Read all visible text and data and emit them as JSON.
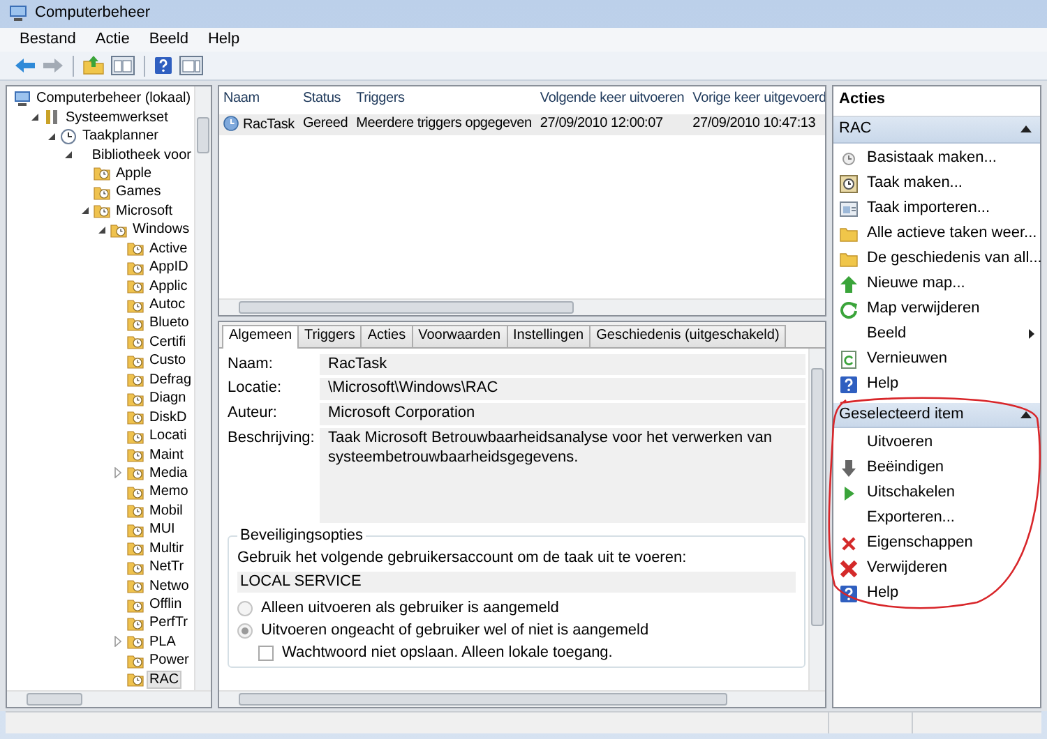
{
  "window": {
    "title": "Computerbeheer"
  },
  "menu": [
    "Bestand",
    "Actie",
    "Beeld",
    "Help"
  ],
  "tree": [
    {
      "label": "Computerbeheer (lokaal)",
      "children": [
        {
          "label": "Systeemwerkset",
          "expanded": true,
          "children": [
            {
              "label": "Taakplanner",
              "expanded": true,
              "children": [
                {
                  "label": "Bibliotheek voor",
                  "expanded": true,
                  "children": [
                    {
                      "label": "Apple"
                    },
                    {
                      "label": "Games"
                    },
                    {
                      "label": "Microsoft",
                      "expanded": true,
                      "children": [
                        {
                          "label": "Windows",
                          "expanded": true,
                          "children": [
                            {
                              "label": "Active",
                              "selected": false
                            },
                            {
                              "label": "AppID",
                              "selected": false
                            },
                            {
                              "label": "Applic",
                              "selected": false
                            },
                            {
                              "label": "Autoc",
                              "selected": false
                            },
                            {
                              "label": "Blueto",
                              "selected": false
                            },
                            {
                              "label": "Certifi",
                              "selected": false
                            },
                            {
                              "label": "Custo",
                              "selected": false
                            },
                            {
                              "label": "Defrag",
                              "selected": false
                            },
                            {
                              "label": "Diagn",
                              "selected": false
                            },
                            {
                              "label": "DiskD",
                              "selected": false
                            },
                            {
                              "label": "Locati",
                              "selected": false
                            },
                            {
                              "label": "Maint",
                              "selected": false
                            },
                            {
                              "label": "Media",
                              "selected": false,
                              "expanded": false
                            },
                            {
                              "label": "Memo",
                              "selected": false
                            },
                            {
                              "label": "Mobil",
                              "selected": false
                            },
                            {
                              "label": "MUI",
                              "selected": false
                            },
                            {
                              "label": "Multir",
                              "selected": false
                            },
                            {
                              "label": "NetTr",
                              "selected": false
                            },
                            {
                              "label": "Netwo",
                              "selected": false
                            },
                            {
                              "label": "Offlin",
                              "selected": false
                            },
                            {
                              "label": "PerfTr",
                              "selected": false
                            },
                            {
                              "label": "PLA",
                              "selected": false,
                              "expanded": false
                            },
                            {
                              "label": "Power",
                              "selected": false
                            },
                            {
                              "label": "RAC",
                              "selected": true
                            }
                          ]
                        }
                      ]
                    }
                  ]
                }
              ]
            }
          ]
        }
      ]
    }
  ],
  "tasks": {
    "columns": [
      "Naam",
      "Status",
      "Triggers",
      "Volgende keer uitvoeren",
      "Vorige keer uitgevoerd"
    ],
    "rows": [
      {
        "cells": [
          "RacTask",
          "Gereed",
          "Meerdere triggers opgegeven",
          "27/09/2010 12:00:07",
          "27/09/2010 10:47:13"
        ],
        "selected": true
      }
    ]
  },
  "details": {
    "tabs": [
      {
        "label": "Algemeen",
        "selected": true
      },
      {
        "label": "Triggers",
        "selected": false
      },
      {
        "label": "Acties",
        "selected": false
      },
      {
        "label": "Voorwaarden",
        "selected": false
      },
      {
        "label": "Instellingen",
        "selected": false
      },
      {
        "label": "Geschiedenis (uitgeschakeld)",
        "selected": false
      }
    ],
    "fields": [
      {
        "label": "Naam:",
        "value": "RacTask",
        "kind": "line"
      },
      {
        "label": "Locatie:",
        "value": "\\Microsoft\\Windows\\RAC",
        "kind": "line"
      },
      {
        "label": "Auteur:",
        "value": "Microsoft Corporation",
        "kind": "line"
      },
      {
        "label": "Beschrijving:",
        "value": "Taak Microsoft Betrouwbaarheidsanalyse voor het verwerken van systeembetrouwbaarheidsgegevens.",
        "kind": "multiline"
      }
    ],
    "security": {
      "title": "Beveiligingsopties",
      "prompt": "Gebruik het volgende gebruikersaccount om de taak uit te voeren:",
      "account": "LOCAL SERVICE",
      "options": [
        {
          "kind": "radio",
          "label": "Alleen uitvoeren als gebruiker is aangemeld",
          "selected": false
        },
        {
          "kind": "radio",
          "label": "Uitvoeren ongeacht of gebruiker wel of niet is aangemeld",
          "selected": true
        },
        {
          "kind": "checkbox",
          "label": "Wachtwoord niet opslaan. Alleen lokale toegang.",
          "checked": false
        }
      ]
    }
  },
  "actions": {
    "title": "Acties",
    "sections": [
      {
        "title": "RAC",
        "expanded": true,
        "items": [
          {
            "label": "Basistaak maken...",
            "submenu": false
          },
          {
            "label": "Taak maken...",
            "submenu": false
          },
          {
            "label": "Taak importeren...",
            "submenu": false
          },
          {
            "label": "Alle actieve taken weer...",
            "submenu": false
          },
          {
            "label": "De geschiedenis van all...",
            "submenu": false
          },
          {
            "label": "Nieuwe map...",
            "submenu": false
          },
          {
            "label": "Map verwijderen",
            "submenu": false
          },
          {
            "label": "Beeld",
            "submenu": true
          },
          {
            "label": "Vernieuwen",
            "submenu": false
          },
          {
            "label": "Help",
            "submenu": false
          }
        ]
      },
      {
        "title": "Geselecteerd item",
        "expanded": true,
        "items": [
          {
            "label": "Uitvoeren"
          },
          {
            "label": "Beëindigen"
          },
          {
            "label": "Uitschakelen"
          },
          {
            "label": "Exporteren..."
          },
          {
            "label": "Eigenschappen"
          },
          {
            "label": "Verwijderen"
          },
          {
            "label": "Help"
          }
        ]
      }
    ]
  }
}
